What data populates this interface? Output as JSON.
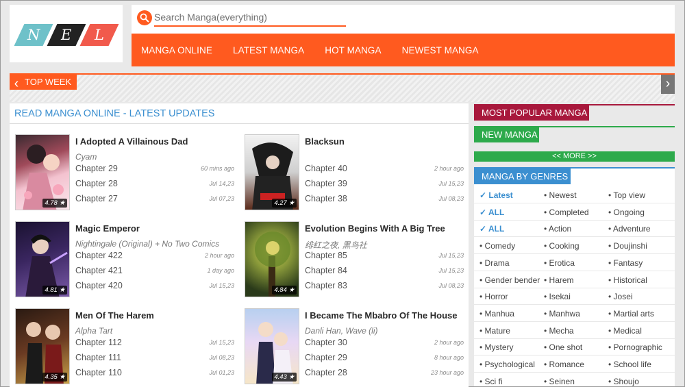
{
  "logo": {
    "letters": [
      "N",
      "E",
      "L"
    ],
    "colors": [
      "#6ec1c9",
      "#222222",
      "#f15a4c"
    ]
  },
  "search": {
    "placeholder": "Search Manga(everything)"
  },
  "nav": [
    "MANGA ONLINE",
    "LATEST MANGA",
    "HOT MANGA",
    "NEWEST MANGA"
  ],
  "top_week": {
    "label": "TOP WEEK"
  },
  "main": {
    "title": "READ MANGA ONLINE - LATEST UPDATES",
    "items": [
      {
        "title": "I Adopted A Villainous Dad",
        "author": "Cyam",
        "rating": "4.78 ★",
        "chapters": [
          {
            "name": "Chapter 29",
            "time": "60 mins ago"
          },
          {
            "name": "Chapter 28",
            "time": "Jul 14,23"
          },
          {
            "name": "Chapter 27",
            "time": "Jul 07,23"
          }
        ]
      },
      {
        "title": "Blacksun",
        "author": "",
        "rating": "4.27 ★",
        "chapters": [
          {
            "name": "Chapter 40",
            "time": "2 hour ago"
          },
          {
            "name": "Chapter 39",
            "time": "Jul 15,23"
          },
          {
            "name": "Chapter 38",
            "time": "Jul 08,23"
          }
        ]
      },
      {
        "title": "Magic Emperor",
        "author": "Nightingale (Original) + No Two Comics",
        "rating": "4.81 ★",
        "chapters": [
          {
            "name": "Chapter 422",
            "time": "2 hour ago"
          },
          {
            "name": "Chapter 421",
            "time": "1 day ago"
          },
          {
            "name": "Chapter 420",
            "time": "Jul 15,23"
          }
        ]
      },
      {
        "title": "Evolution Begins With A Big Tree",
        "author": "绯红之夜, 黑鸟社",
        "rating": "4.84 ★",
        "chapters": [
          {
            "name": "Chapter 85",
            "time": "Jul 15,23"
          },
          {
            "name": "Chapter 84",
            "time": "Jul 15,23"
          },
          {
            "name": "Chapter 83",
            "time": "Jul 08,23"
          }
        ]
      },
      {
        "title": "Men Of The Harem",
        "author": "Alpha Tart",
        "rating": "4.35 ★",
        "chapters": [
          {
            "name": "Chapter 112",
            "time": "Jul 15,23"
          },
          {
            "name": "Chapter 111",
            "time": "Jul 08,23"
          },
          {
            "name": "Chapter 110",
            "time": "Jul 01,23"
          }
        ]
      },
      {
        "title": "I Became The Mbabro Of The House",
        "author": "Danli Han, Wave (li)",
        "rating": "4.43 ★",
        "chapters": [
          {
            "name": "Chapter 30",
            "time": "2 hour ago"
          },
          {
            "name": "Chapter 29",
            "time": "8 hour ago"
          },
          {
            "name": "Chapter 28",
            "time": "23 hour ago"
          }
        ]
      }
    ]
  },
  "sidebar": {
    "most_popular": "MOST POPULAR MANGA",
    "new_manga": "NEW MANGA",
    "more": "<< MORE >>",
    "genres_title": "MANGA BY GENRES",
    "genre_rows": [
      [
        "✓ Latest",
        "• Newest",
        "• Top view"
      ],
      [
        "✓ ALL",
        "• Completed",
        "• Ongoing"
      ],
      [
        "✓ ALL",
        "• Action",
        "• Adventure"
      ],
      [
        "• Comedy",
        "• Cooking",
        "• Doujinshi"
      ],
      [
        "• Drama",
        "• Erotica",
        "• Fantasy"
      ],
      [
        "• Gender bender",
        "• Harem",
        "• Historical"
      ],
      [
        "• Horror",
        "• Isekai",
        "• Josei"
      ],
      [
        "• Manhua",
        "• Manhwa",
        "• Martial arts"
      ],
      [
        "• Mature",
        "• Mecha",
        "• Medical"
      ],
      [
        "• Mystery",
        "• One shot",
        "• Pornographic"
      ],
      [
        "• Psychological",
        "• Romance",
        "• School life"
      ],
      [
        "• Sci fi",
        "• Seinen",
        "• Shoujo"
      ]
    ]
  },
  "colors": {
    "accent": "#ff5a1f",
    "blue": "#3b8fd0",
    "green": "#2daa4b",
    "crimson": "#a8183c"
  }
}
